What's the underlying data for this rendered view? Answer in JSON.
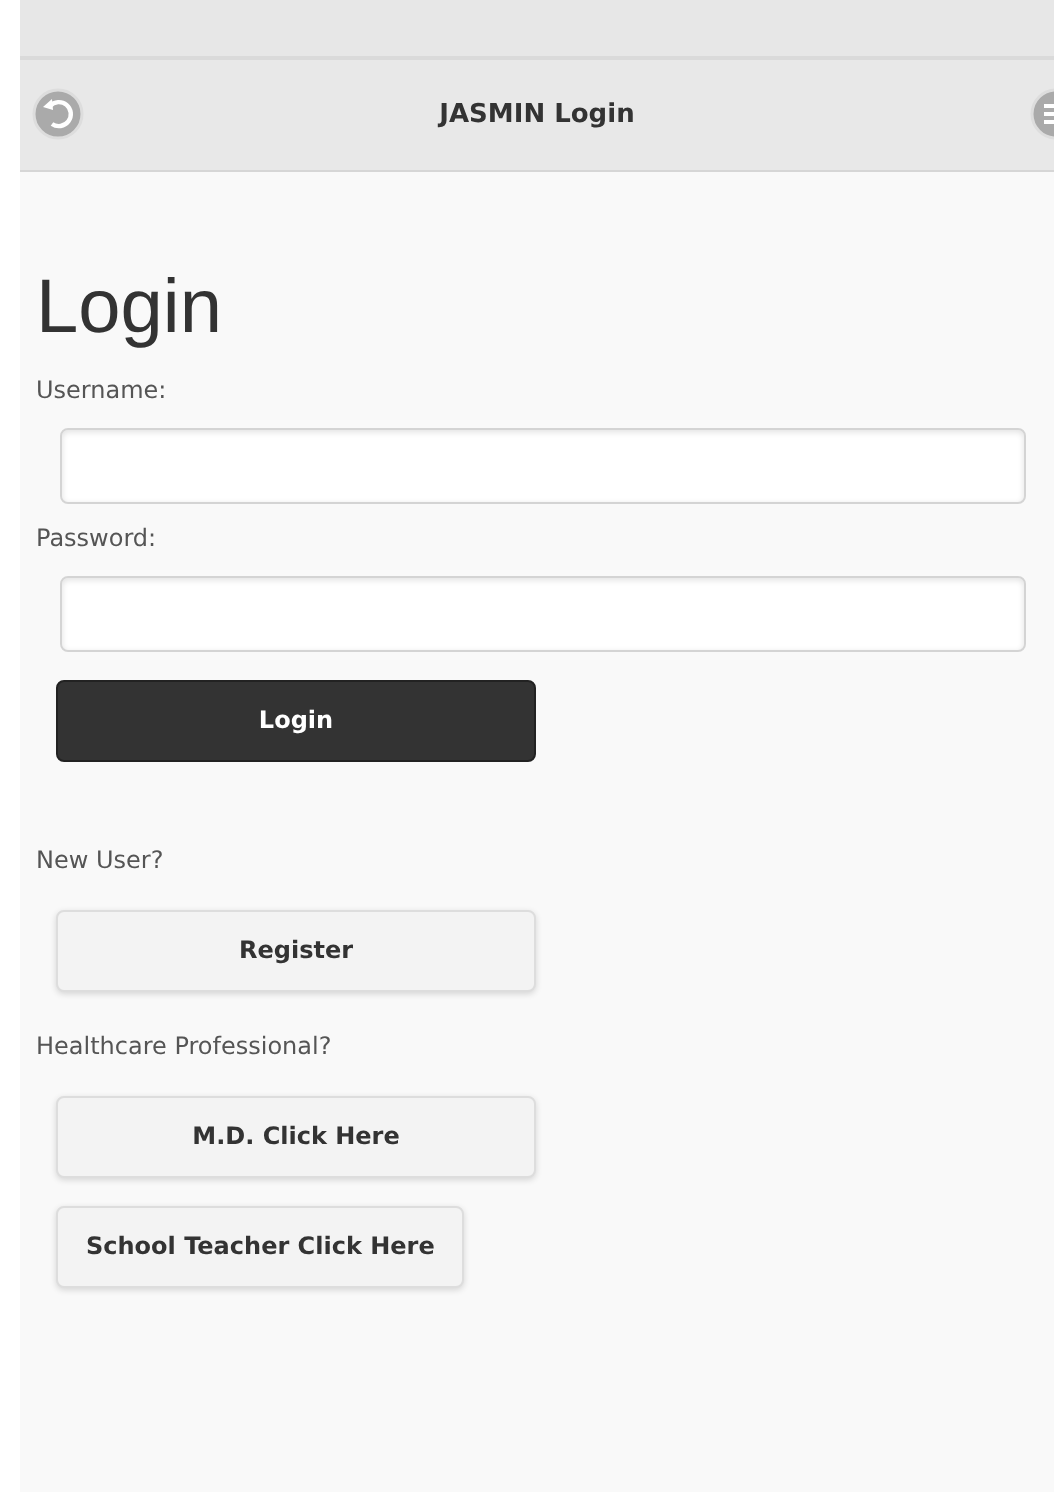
{
  "header": {
    "title": "JASMIN Login"
  },
  "heading": "Login",
  "fields": [
    {
      "label": "Username:"
    },
    {
      "label": "Password:"
    }
  ],
  "items": [
    {
      "kind": "primary",
      "text": "Login"
    },
    {
      "kind": "prompt",
      "text": "New User?"
    },
    {
      "kind": "button",
      "text": "Register"
    },
    {
      "kind": "prompt",
      "text": "Healthcare Professional?"
    },
    {
      "kind": "button",
      "text": "M.D. Click Here"
    },
    {
      "kind": "inline-button",
      "text": "School Teacher Click Here"
    }
  ]
}
